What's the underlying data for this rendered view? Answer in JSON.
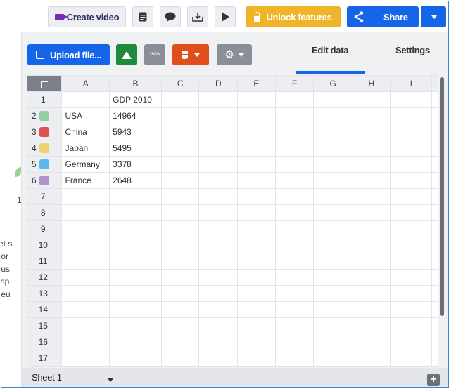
{
  "toolbar": {
    "create_video": "Create video",
    "unlock": "Unlock features",
    "share": "Share"
  },
  "panel": {
    "upload": "Upload file...",
    "json": "JSON",
    "tabs": {
      "edit": "Edit data",
      "settings": "Settings"
    }
  },
  "grid": {
    "columns": [
      "A",
      "B",
      "C",
      "D",
      "E",
      "F",
      "G",
      "H",
      "I"
    ],
    "rows": [
      {
        "n": "1",
        "a": "",
        "b": "GDP 2010",
        "color": ""
      },
      {
        "n": "2",
        "a": "USA",
        "b": "14964",
        "color": "#93cfa0"
      },
      {
        "n": "3",
        "a": "China",
        "b": "5943",
        "color": "#e0524f"
      },
      {
        "n": "4",
        "a": "Japan",
        "b": "5495",
        "color": "#f2cf6d"
      },
      {
        "n": "5",
        "a": "Germany",
        "b": "3378",
        "color": "#5ab7ee"
      },
      {
        "n": "6",
        "a": "France",
        "b": "2648",
        "color": "#ae93cc"
      },
      {
        "n": "7",
        "a": "",
        "b": "",
        "color": ""
      },
      {
        "n": "8",
        "a": "",
        "b": "",
        "color": ""
      },
      {
        "n": "9",
        "a": "",
        "b": "",
        "color": ""
      },
      {
        "n": "10",
        "a": "",
        "b": "",
        "color": ""
      },
      {
        "n": "11",
        "a": "",
        "b": "",
        "color": ""
      },
      {
        "n": "12",
        "a": "",
        "b": "",
        "color": ""
      },
      {
        "n": "13",
        "a": "",
        "b": "",
        "color": ""
      },
      {
        "n": "14",
        "a": "",
        "b": "",
        "color": ""
      },
      {
        "n": "15",
        "a": "",
        "b": "",
        "color": ""
      },
      {
        "n": "16",
        "a": "",
        "b": "",
        "color": ""
      },
      {
        "n": "17",
        "a": "",
        "b": "",
        "color": ""
      }
    ]
  },
  "sheet": {
    "name": "Sheet 1"
  },
  "background_fragments": [
    "et s",
    "tor",
    "tus",
    "isp",
    "feu",
    "1"
  ],
  "colors": {
    "accent": "#1565e8",
    "unlock": "#f0b429",
    "drive": "#1f8a3c",
    "database": "#e04e1b"
  }
}
